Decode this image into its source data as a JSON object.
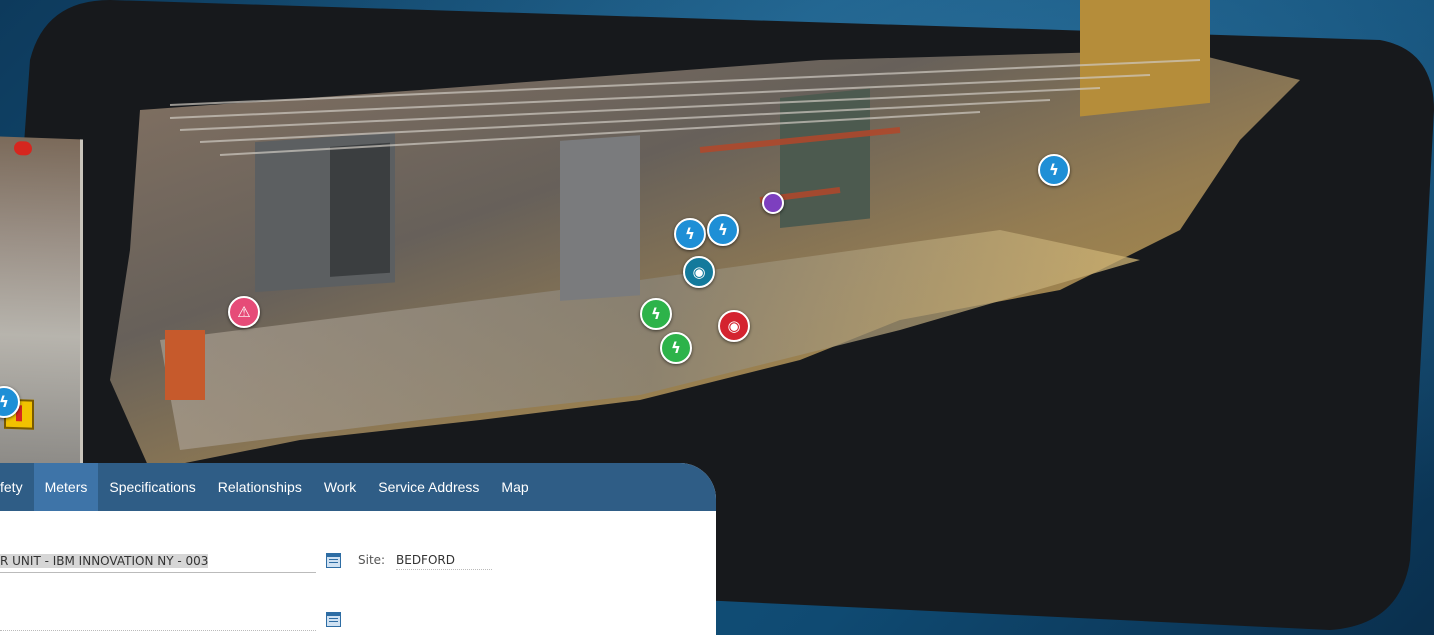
{
  "tabs": {
    "safety": "fety",
    "meters": "Meters",
    "specifications": "Specifications",
    "relationships": "Relationships",
    "work": "Work",
    "service_address": "Service Address",
    "map": "Map"
  },
  "form": {
    "location_value": "R UNIT - IBM INNOVATION NY - 003",
    "site_label": "Site:",
    "site_value": "BEDFORD",
    "second_value": ""
  },
  "tags": {
    "warning": "⚠",
    "lightning": "ϟ",
    "gauge": "◉"
  },
  "colors": {
    "tabbar": "#2f5d86",
    "active_tab": "#3e74a8",
    "background": "#16567f",
    "scene_black": "#17191c"
  }
}
